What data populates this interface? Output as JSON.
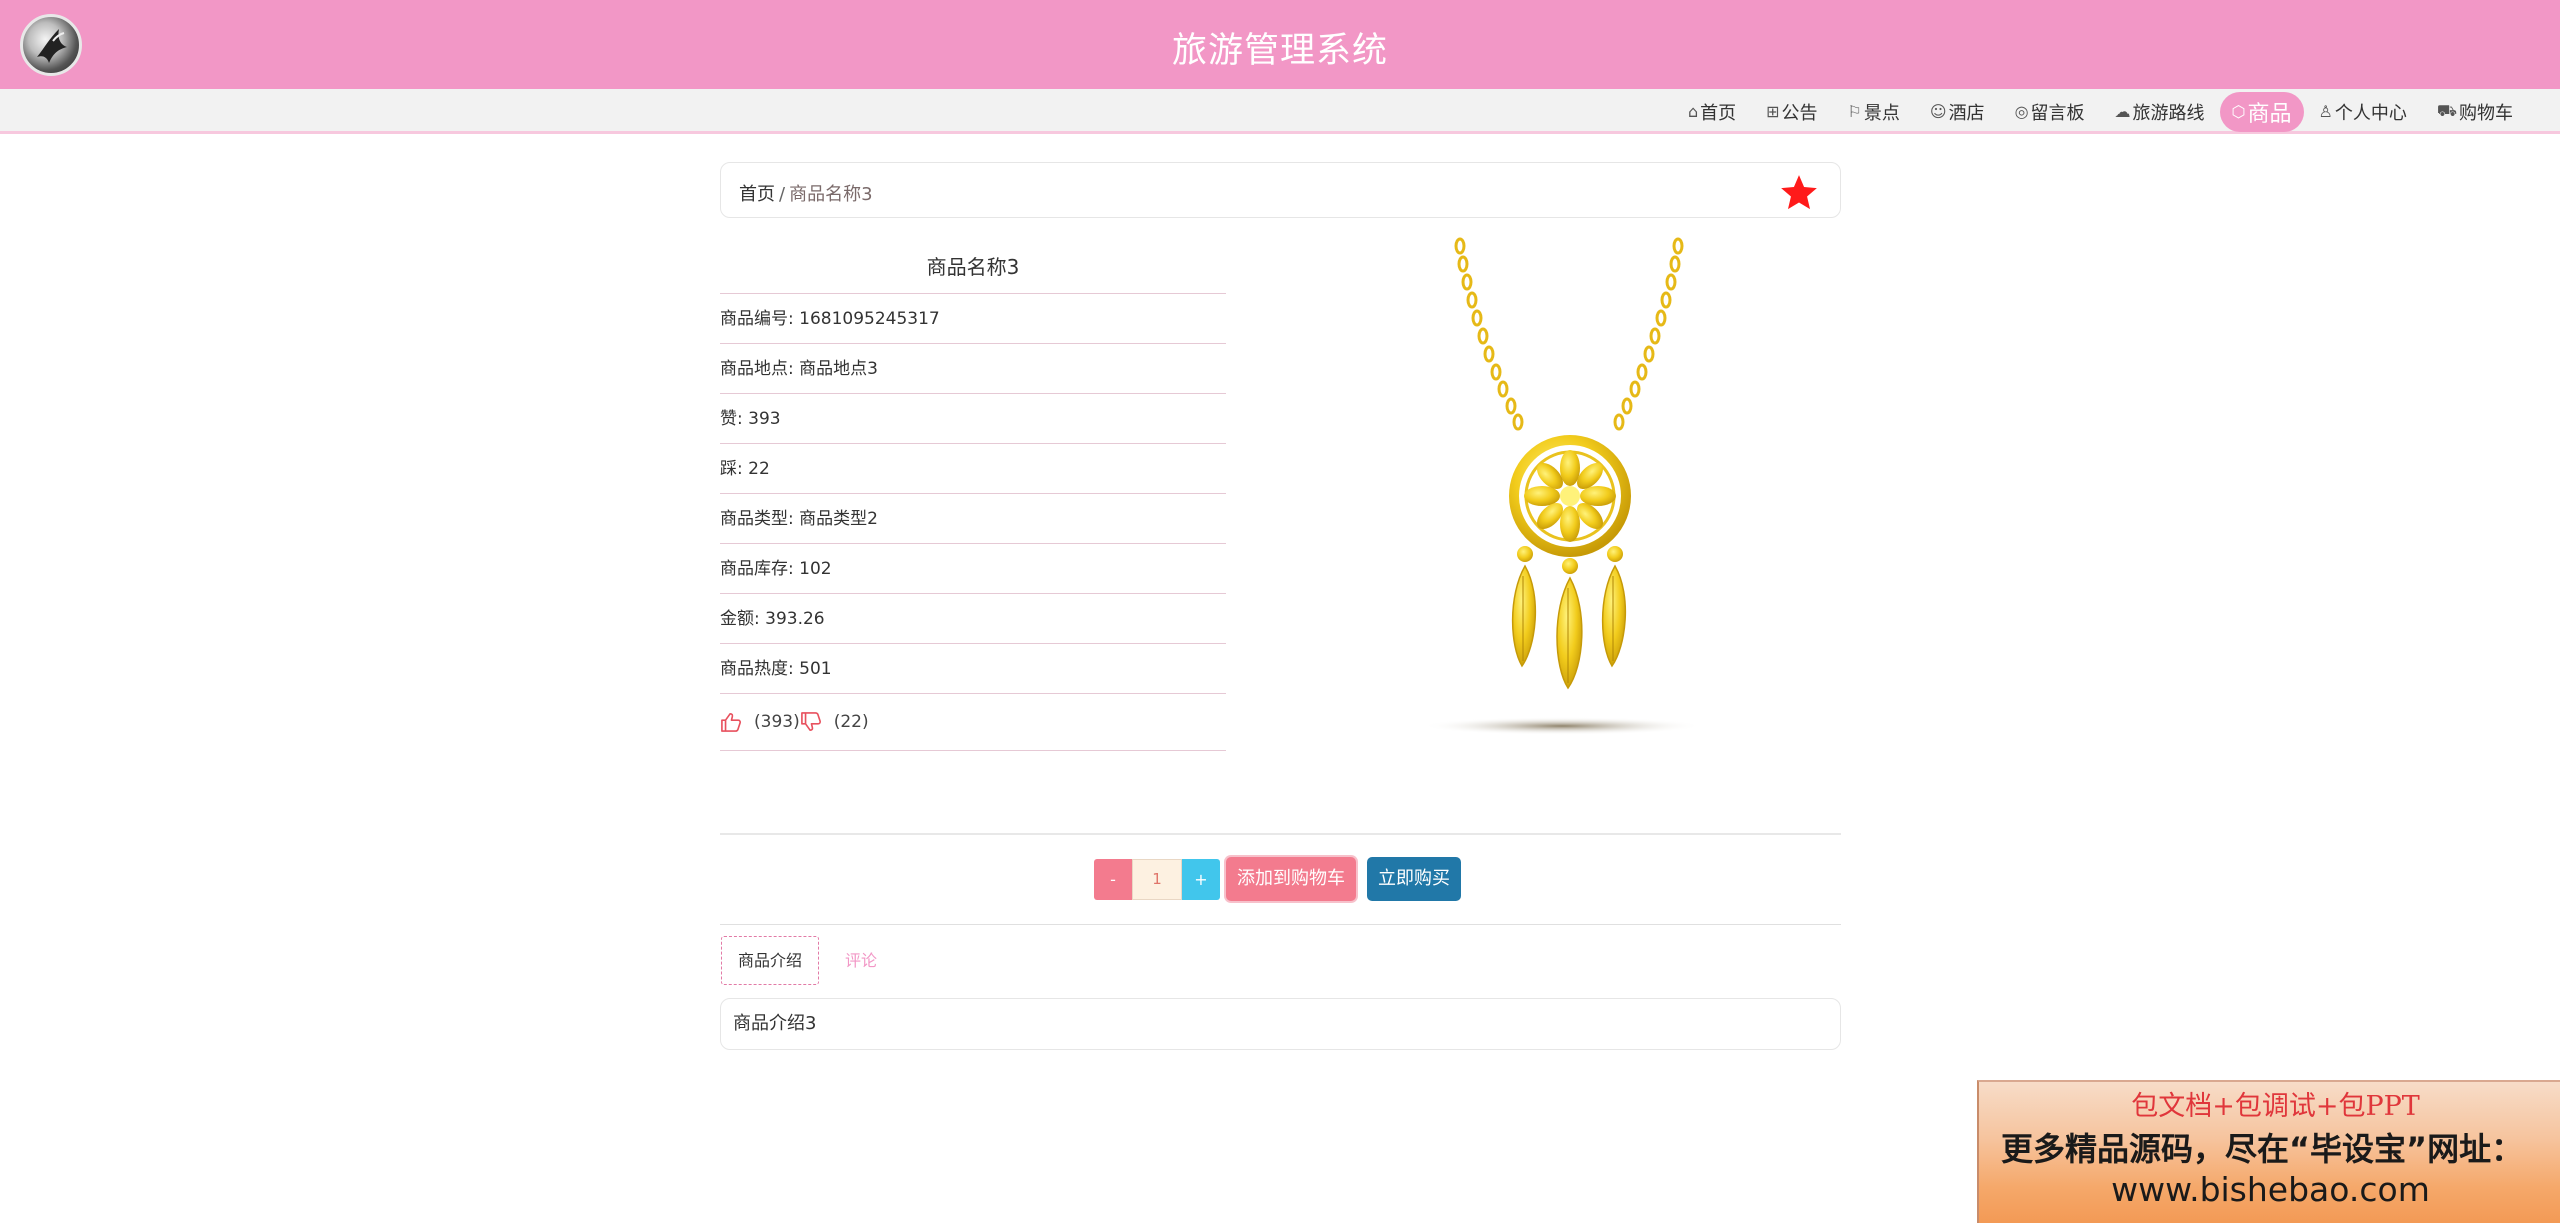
{
  "header": {
    "title": "旅游管理系统"
  },
  "nav": [
    {
      "label": "首页",
      "icon": "home-icon",
      "glyph": "⌂",
      "active": false
    },
    {
      "label": "公告",
      "icon": "announcement-icon",
      "glyph": "⊞",
      "active": false
    },
    {
      "label": "景点",
      "icon": "flag-icon",
      "glyph": "⚐",
      "active": false
    },
    {
      "label": "酒店",
      "icon": "hotel-icon",
      "glyph": "☺",
      "active": false
    },
    {
      "label": "留言板",
      "icon": "globe-icon",
      "glyph": "◎",
      "active": false
    },
    {
      "label": "旅游路线",
      "icon": "cloud-icon",
      "glyph": "☁",
      "active": false
    },
    {
      "label": "商品",
      "icon": "cube-icon",
      "glyph": "⬡",
      "active": true
    },
    {
      "label": "个人中心",
      "icon": "user-icon",
      "glyph": "♙",
      "active": false
    },
    {
      "label": "购物车",
      "icon": "cart-icon",
      "glyph": "⛟",
      "active": false
    }
  ],
  "breadcrumb": {
    "home": "首页",
    "separator": "/",
    "current": "商品名称3"
  },
  "product": {
    "name": "商品名称3",
    "rows": [
      {
        "label": "商品编号",
        "value": "1681095245317"
      },
      {
        "label": "商品地点",
        "value": "商品地点3"
      },
      {
        "label": "赞",
        "value": "393"
      },
      {
        "label": "踩",
        "value": "22"
      },
      {
        "label": "商品类型",
        "value": "商品类型2"
      },
      {
        "label": "商品库存",
        "value": "102"
      },
      {
        "label": "金额",
        "value": "393.26"
      },
      {
        "label": "商品热度",
        "value": "501"
      }
    ],
    "likes": "(393)",
    "dislikes": "(22)"
  },
  "actions": {
    "minus": "-",
    "quantity": "1",
    "plus": "+",
    "add_to_cart": "添加到购物车",
    "buy_now": "立即购买"
  },
  "tabs": {
    "intro": "商品介绍",
    "comments": "评论"
  },
  "description": "商品介绍3",
  "ad": {
    "line1": "包文档+包调试+包PPT",
    "line2": "更多精品源码，尽在“毕设宝”网址：",
    "line3": "www.bishebao.com"
  },
  "colors": {
    "primary": "#f297c6",
    "star": "#ff1a1a",
    "buy": "#2178a8",
    "cart": "#f37b8e"
  }
}
